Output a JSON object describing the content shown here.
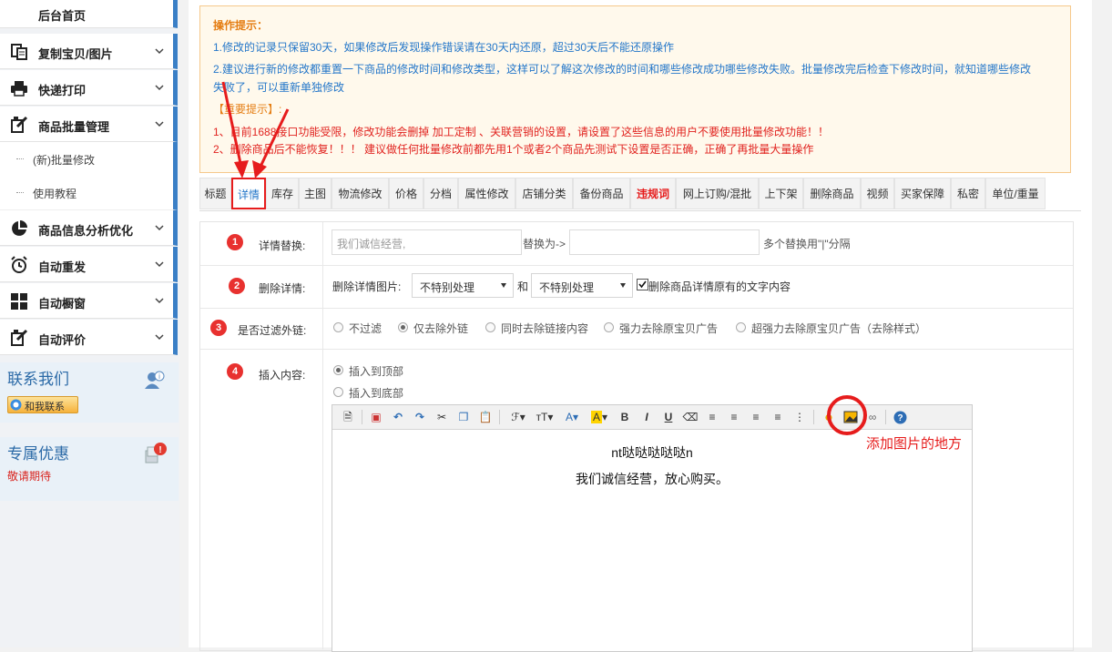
{
  "sidebar": {
    "items": [
      {
        "label": "后台首页",
        "icon": "home-icon"
      },
      {
        "label": "复制宝贝/图片",
        "icon": "copy-icon"
      },
      {
        "label": "快递打印",
        "icon": "printer-icon"
      },
      {
        "label": "商品批量管理",
        "icon": "edit-icon"
      },
      {
        "label": "商品信息分析优化",
        "icon": "pie-chart-icon"
      },
      {
        "label": "自动重发",
        "icon": "alarm-clock-icon"
      },
      {
        "label": "自动橱窗",
        "icon": "grid-icon"
      },
      {
        "label": "自动评价",
        "icon": "edit-icon"
      }
    ],
    "sub_items": [
      "(新)批量修改",
      "使用教程"
    ],
    "contact": {
      "title": "联系我们",
      "button": "和我联系"
    },
    "promo": {
      "title": "专属优惠",
      "text": "敬请期待"
    }
  },
  "notice": {
    "heading": "操作提示：",
    "lines": [
      "1.修改的记录只保留30天，如果修改后发现操作错误请在30天内还原，超过30天后不能还原操作",
      "2.建议进行新的修改都重置一下商品的修改时间和修改类型，这样可以了解这次修改的时间和哪些修改成功哪些修改失败。批量修改完后检查下修改时间，就知道哪些修改",
      "失败了，可以重新单独修改"
    ],
    "important_heading": "【重要提示】:",
    "important_lines": [
      "1、目前1688接口功能受限，修改功能会删掉 加工定制 、关联营销的设置，请设置了这些信息的用户不要使用批量修改功能！！",
      "2、删除商品后不能恢复！！！ 建议做任何批量修改前都先用1个或者2个商品先测试下设置是否正确，正确了再批量大量操作"
    ]
  },
  "tabs": [
    "标题",
    "详情",
    "库存",
    "主图",
    "物流修改",
    "价格",
    "分档",
    "属性修改",
    "店铺分类",
    "备份商品",
    "违规词",
    "网上订购/混批",
    "上下架",
    "删除商品",
    "视频",
    "买家保障",
    "私密",
    "单位/重量"
  ],
  "active_tab": "详情",
  "form": {
    "detail_replace": {
      "num": "1",
      "label": "详情替换:",
      "placeholder": "我们诚信经营,",
      "replace_label": "替换为->",
      "hint": "多个替换用\"|\"分隔"
    },
    "delete_detail": {
      "num": "2",
      "label": "删除详情:",
      "images_label": "删除详情图片:",
      "select1": "不特别处理",
      "and": "和",
      "select2": "不特别处理",
      "checkbox_label": "删除商品详情原有的文字内容",
      "checked": true
    },
    "filter_links": {
      "num": "3",
      "label": "是否过滤外链:",
      "options": [
        "不过滤",
        "仅去除外链",
        "同时去除链接内容",
        "强力去除原宝贝广告",
        "超强力去除原宝贝广告（去除样式）"
      ],
      "selected": 1
    },
    "insert": {
      "num": "4",
      "label": "插入内容:",
      "options": [
        "插入到顶部",
        "插入到底部"
      ],
      "selected": 0
    }
  },
  "editor": {
    "lines": [
      "nt哒哒哒哒哒n",
      "我们诚信经营，放心购买。"
    ]
  },
  "annotation": {
    "text": "添加图片的地方",
    "color": "#e61c1c"
  }
}
